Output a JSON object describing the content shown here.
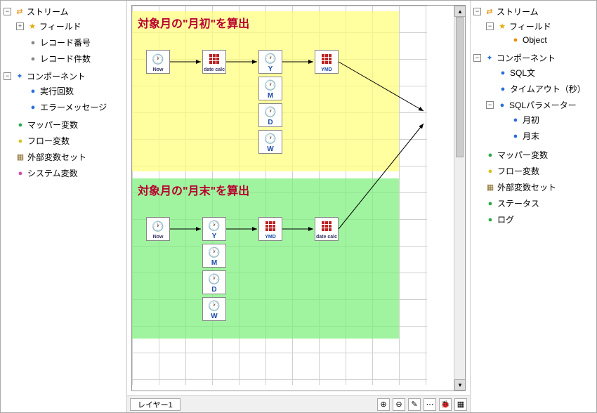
{
  "leftTree": {
    "stream": "ストリーム",
    "field": "フィールド",
    "recordNo": "レコード番号",
    "recordCount": "レコード件数",
    "component": "コンポーネント",
    "execCount": "実行回数",
    "errorMsg": "エラーメッセージ",
    "mapperVar": "マッパー変数",
    "flowVar": "フロー変数",
    "extVarSet": "外部変数セット",
    "systemVar": "システム変数"
  },
  "rightTree": {
    "stream": "ストリーム",
    "field": "フィールド",
    "object": "Object",
    "component": "コンポーネント",
    "sqlText": "SQL文",
    "timeout": "タイムアウト（秒）",
    "sqlParam": "SQLパラメーター",
    "monthStart": "月初",
    "monthEnd": "月末",
    "mapperVar": "マッパー変数",
    "flowVar": "フロー変数",
    "extVarSet": "外部変数セット",
    "status": "ステータス",
    "log": "ログ"
  },
  "canvas": {
    "region1Title": "対象月の\"月初\"を算出",
    "region2Title": "対象月の\"月末\"を算出",
    "nodes": {
      "now": "Now",
      "dateCalc": "date calc",
      "y": "Y",
      "m": "M",
      "d": "D",
      "w": "W",
      "ymd": "YMD"
    }
  },
  "bottomBar": {
    "layerTab": "レイヤー1"
  }
}
